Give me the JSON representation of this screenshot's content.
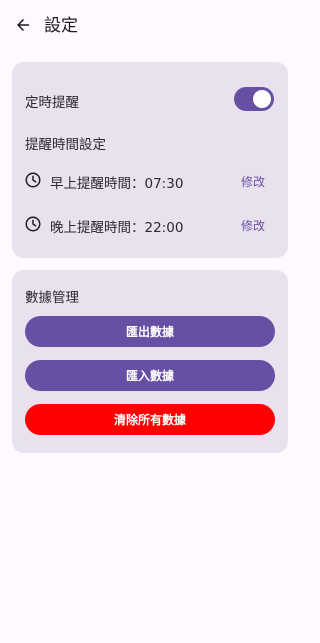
{
  "app_bar": {
    "title": "設定",
    "back_icon": "arrow-left-icon"
  },
  "reminder_card": {
    "timed_reminder_label": "定時提醒",
    "timed_reminder_enabled": true,
    "section_label": "提醒時間設定",
    "morning": {
      "label": "早上提醒時間：07:30",
      "edit_label": "修改",
      "icon": "clock-icon"
    },
    "evening": {
      "label": "晚上提醒時間：22:00",
      "edit_label": "修改",
      "icon": "clock-icon"
    }
  },
  "data_card": {
    "section_label": "數據管理",
    "export_label": "匯出數據",
    "import_label": "匯入數據",
    "clear_label": "清除所有數據"
  },
  "colors": {
    "primary": "#6750a4",
    "danger": "#ff0000",
    "card_background": "#e9e2ee",
    "page_background": "#fdf9ff"
  }
}
